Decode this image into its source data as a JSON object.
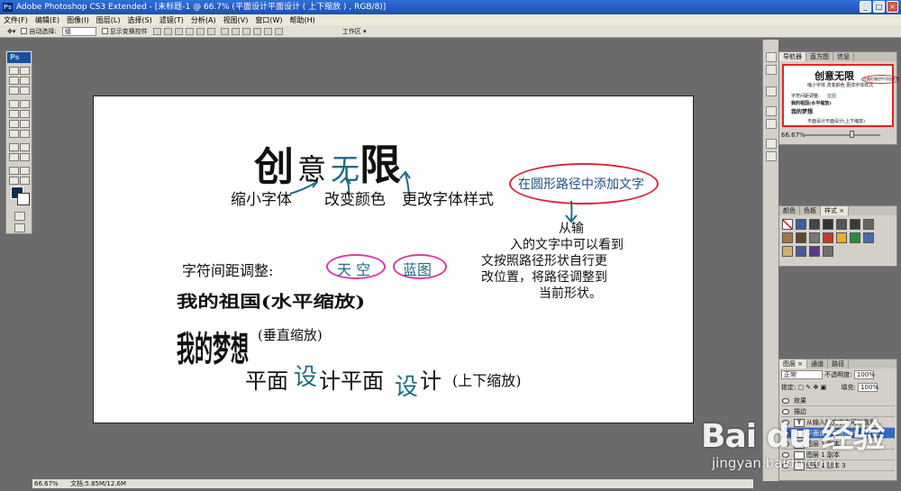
{
  "window": {
    "title": "Adobe Photoshop CS3 Extended - [未标题-1 @ 66.7% (平面设计平面设计 ( 上下缩放 ) , RGB/8)]",
    "logo": "Ps"
  },
  "window_buttons": {
    "minimize": "_",
    "maximize": "□",
    "close": "×"
  },
  "menu": [
    "文件(F)",
    "编辑(E)",
    "图像(I)",
    "图层(L)",
    "选择(S)",
    "滤镜(T)",
    "分析(A)",
    "视图(V)",
    "窗口(W)",
    "帮助(H)"
  ],
  "options": {
    "auto_select": "自动选择:",
    "auto_select_value": "组",
    "show_transform": "显示变换控件",
    "workspace": "工作区 ▾"
  },
  "canvas": {
    "title_chars": [
      "创",
      "意",
      "无",
      "限"
    ],
    "shrink_label": "缩小字体",
    "color_label": "改变颜色",
    "style_label": "更改字体样式",
    "circle_text": "在圆形路径中添加文字",
    "para_lines": [
      "从输",
      "入的文字中可以看到",
      "文按照路径形状自行更",
      "改位置，将路径调整到",
      "当前形状。"
    ],
    "spacing_label": "字符间距调整:",
    "sky": "天 空",
    "blue": "蓝图",
    "h_scale": "我的祖国(水平缩放)",
    "v_scale_text": "我的梦想",
    "v_scale_label": "(垂直缩放)",
    "ud_a1": "平面",
    "ud_b1": "设",
    "ud_c1": "计平面",
    "ud_b2": "设",
    "ud_c2": "计",
    "ud_label": "(上下缩放)"
  },
  "colors": {
    "teal": "#1d6b86",
    "red_oval": "#d9263a",
    "magenta_oval": "#d83aa8",
    "text_blue": "#1c4f86"
  },
  "status": {
    "zoom": "66.67%",
    "doc": "文档:5.85M/12.6M"
  },
  "navigator": {
    "tabs": [
      "导航器",
      "直方图",
      "信息"
    ],
    "zoom": "66.67%",
    "thumb": {
      "title": "创意无限",
      "l1": "缩小字体 改变颜色 更改字体样式",
      "l2": "字符间距调整:",
      "l3": "我的祖国(水平缩放)",
      "l4": "我的梦想",
      "l5": "平面设计平面设计(上下缩放)",
      "circle": "在圆形路径中添加文字",
      "blue": "蓝图"
    }
  },
  "styles": {
    "tabs": [
      "颜色",
      "色板",
      "样式 ×"
    ]
  },
  "layers": {
    "tabs": [
      "图层 ×",
      "通道",
      "路径"
    ],
    "blend": "正常",
    "opacity_label": "不透明度:",
    "opacity": "100%",
    "lock_label": "锁定:",
    "fill_label": "填充:",
    "fill": "100%",
    "rows": [
      {
        "name": "效果",
        "active": false
      },
      {
        "name": "描边",
        "active": false
      },
      {
        "name": "从输入的文字中可以看到...",
        "active": false
      },
      {
        "name": "平面设计平面设计(上下缩...",
        "active": true
      },
      {
        "name": "图层 1 副本 4",
        "active": false
      },
      {
        "name": "图层 1 副本",
        "active": false
      },
      {
        "name": "图层 1 副本 3",
        "active": false
      }
    ]
  },
  "watermark": {
    "main": "Bai du 经验",
    "sub": "jingyan.baidu.com"
  }
}
